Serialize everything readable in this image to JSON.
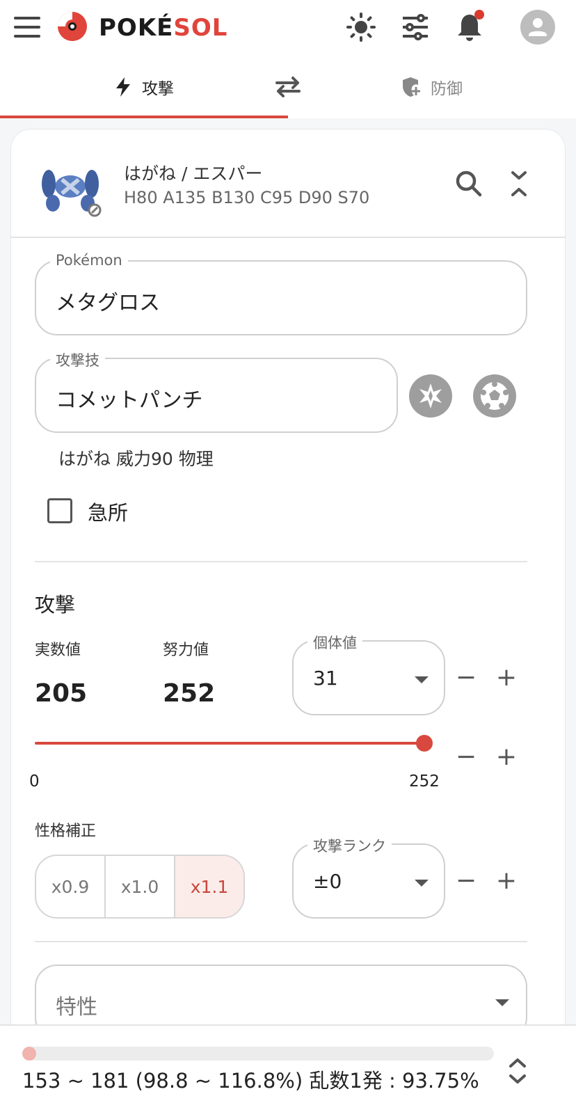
{
  "app": {
    "logo_text_main": "POKÉ",
    "logo_text_accent": "SOL",
    "accent_color": "#d9483e",
    "icons": [
      "hamburger-menu-icon",
      "sun-icon",
      "sliders-icon",
      "bell-icon",
      "account-icon"
    ]
  },
  "tabs": {
    "attack_label": "攻撃",
    "defense_label": "防御"
  },
  "pokemon": {
    "type_line": "はがね / エスパー",
    "stats_line": "H80 A135 B130 C95 D90 S70",
    "field_label": "Pokémon",
    "name": "メタグロス"
  },
  "move": {
    "field_label": "攻撃技",
    "name": "コメットパンチ",
    "info": "はがね 威力90 物理",
    "crit_label": "急所"
  },
  "attack": {
    "section_title": "攻撃",
    "actual_label": "実数値",
    "actual_value": "205",
    "ev_label": "努力値",
    "ev_value": "252",
    "iv_label": "個体値",
    "iv_value": "31",
    "slider_min": "0",
    "slider_max": "252",
    "slider_value": 252,
    "nature_label": "性格補正",
    "nature_options": [
      "x0.9",
      "x1.0",
      "x1.1"
    ],
    "nature_selected": "x1.1",
    "rank_label": "攻撃ランク",
    "rank_value": "±0"
  },
  "ability": {
    "placeholder": "特性"
  },
  "result": {
    "text": "153 ~ 181 (98.8 ~ 116.8%) 乱数1発 : 93.75%",
    "progress_percent": 3
  },
  "stepper": {
    "minus": "−",
    "plus": "+"
  }
}
